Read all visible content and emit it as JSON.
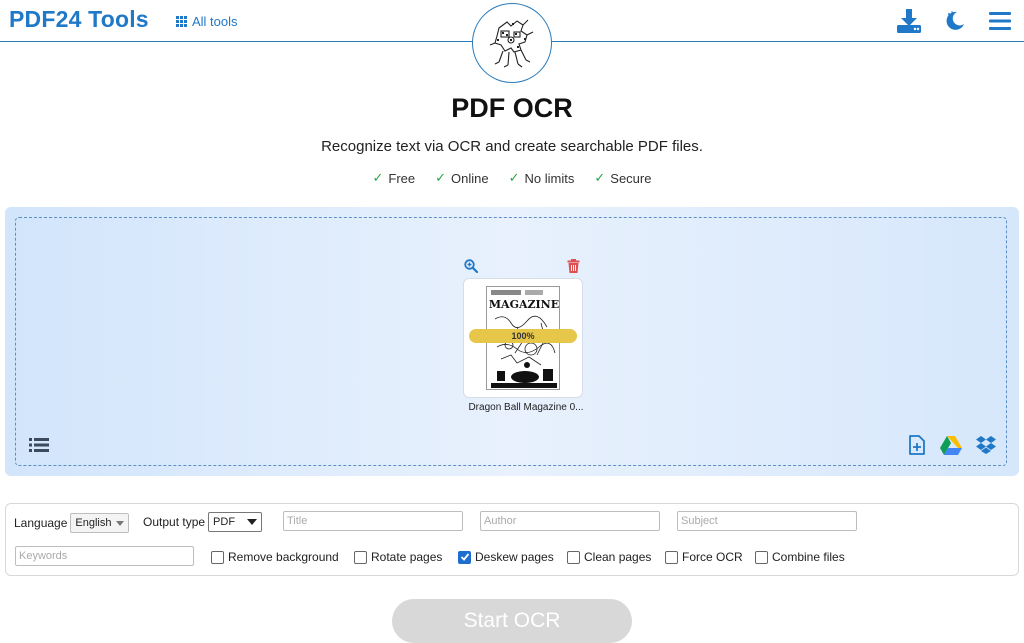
{
  "header": {
    "logo": "PDF24 Tools",
    "all_tools": "All tools",
    "icons": [
      "download-icon",
      "dark-mode-icon",
      "menu-icon"
    ]
  },
  "page": {
    "title": "PDF OCR",
    "subtitle": "Recognize text via OCR and create searchable PDF files.",
    "features": [
      "Free",
      "Online",
      "No limits",
      "Secure"
    ]
  },
  "file": {
    "name": "Dragon Ball Magazine 0...",
    "progress": "100%",
    "thumb_text": "MAGAZINE"
  },
  "options": {
    "language_label": "Language",
    "language_value": "English",
    "output_type_label": "Output type",
    "output_type_value": "PDF",
    "title_placeholder": "Title",
    "author_placeholder": "Author",
    "subject_placeholder": "Subject",
    "keywords_placeholder": "Keywords",
    "checkboxes": [
      {
        "label": "Remove background",
        "checked": false
      },
      {
        "label": "Rotate pages",
        "checked": false
      },
      {
        "label": "Deskew pages",
        "checked": true
      },
      {
        "label": "Clean pages",
        "checked": false
      },
      {
        "label": "Force OCR",
        "checked": false
      },
      {
        "label": "Combine files",
        "checked": false
      }
    ]
  },
  "actions": {
    "start": "Start OCR"
  },
  "colors": {
    "brand": "#1f78c8",
    "check": "#28a745",
    "progress": "#e7c74a",
    "trash": "#e05050",
    "checkbox_on": "#1e6ecf"
  }
}
